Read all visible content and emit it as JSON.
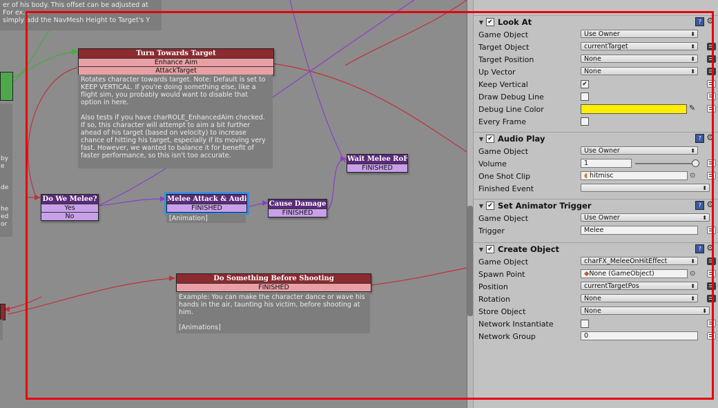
{
  "graph": {
    "top_comment": "er of his body. This offset can be adjusted at\nFor ex...\nsimply add the NavMesh Height to Target's Y",
    "left_comment_fragments": [
      "by",
      "e",
      "de",
      "he",
      "ed",
      "or"
    ],
    "states": {
      "turn_towards": {
        "title": "Turn Towards Target",
        "events": [
          "Enhance Aim",
          "AttackTarget"
        ]
      },
      "do_we_melee": {
        "title": "Do We Melee?",
        "events": [
          "Yes",
          "No"
        ]
      },
      "melee_attack": {
        "title": "Melee Attack & Audio",
        "events": [
          "FINISHED"
        ]
      },
      "cause_damage": {
        "title": "Cause Damage",
        "events": [
          "FINISHED"
        ]
      },
      "wait_melee": {
        "title": "Wait Melee RoF",
        "events": [
          "FINISHED"
        ]
      },
      "do_something": {
        "title": "Do Something Before Shooting",
        "events": [
          "FINISHED"
        ]
      }
    },
    "turn_comment": "Rotates character towards target.  Note: Default is set to KEEP VERTICAL. If you're doing something else, like a flight sim, you probably would want to disable that option in here.\n\nAlso tests if you have charROLE_EnhancedAim checked. If so, this character will attempt to aim a bit further ahead of his target (based on velocity) to increase chance of hitting his target, especially if its moving very fast.  However, we wanted to balance it for benefit of faster performance, so this isn't too accurate.",
    "melee_label": "[Animation]",
    "shoot_comment": "Example: You can make the character dance or wave his hands in the air, taunting his victim, before shooting at him.\n\n[Animations]"
  },
  "inspector": {
    "look_at": {
      "title": "Look At",
      "enabled": true,
      "rows": {
        "game_object": {
          "label": "Game Object",
          "value": "Use Owner"
        },
        "target_object": {
          "label": "Target Object",
          "value": "currentTarget"
        },
        "target_position": {
          "label": "Target Position",
          "value": "None"
        },
        "up_vector": {
          "label": "Up Vector",
          "value": "None"
        },
        "keep_vertical": {
          "label": "Keep Vertical",
          "checked": true
        },
        "draw_debug_line": {
          "label": "Draw Debug Line",
          "checked": false
        },
        "debug_line_color": {
          "label": "Debug Line Color",
          "color": "#ffee00"
        },
        "every_frame": {
          "label": "Every Frame",
          "checked": false
        }
      }
    },
    "audio_play": {
      "title": "Audio Play",
      "enabled": true,
      "rows": {
        "game_object": {
          "label": "Game Object",
          "value": "Use Owner"
        },
        "volume": {
          "label": "Volume",
          "value": "1",
          "slider": 1
        },
        "one_shot_clip": {
          "label": "One Shot Clip",
          "value": "hitmisc"
        },
        "finished_event": {
          "label": "Finished Event",
          "value": ""
        }
      }
    },
    "set_animator_trigger": {
      "title": "Set Animator Trigger",
      "enabled": true,
      "rows": {
        "game_object": {
          "label": "Game Object",
          "value": "Use Owner"
        },
        "trigger": {
          "label": "Trigger",
          "value": "Melee"
        }
      }
    },
    "create_object": {
      "title": "Create Object",
      "enabled": true,
      "rows": {
        "game_object": {
          "label": "Game Object",
          "value": "charFX_MeleeOnHitEffect"
        },
        "spawn_point": {
          "label": "Spawn Point",
          "value": "None (GameObject)"
        },
        "position": {
          "label": "Position",
          "value": "currentTargetPos"
        },
        "rotation": {
          "label": "Rotation",
          "value": "None"
        },
        "store_object": {
          "label": "Store Object",
          "value": "None"
        },
        "network_instantiate": {
          "label": "Network Instantiate",
          "checked": false
        },
        "network_group": {
          "label": "Network Group",
          "value": "0"
        }
      }
    }
  },
  "colors": {
    "state_red": "#8b2a2f",
    "state_purple": "#5a2a7a",
    "selection": "#3b8de0",
    "highlight_frame": "#e8000b"
  }
}
